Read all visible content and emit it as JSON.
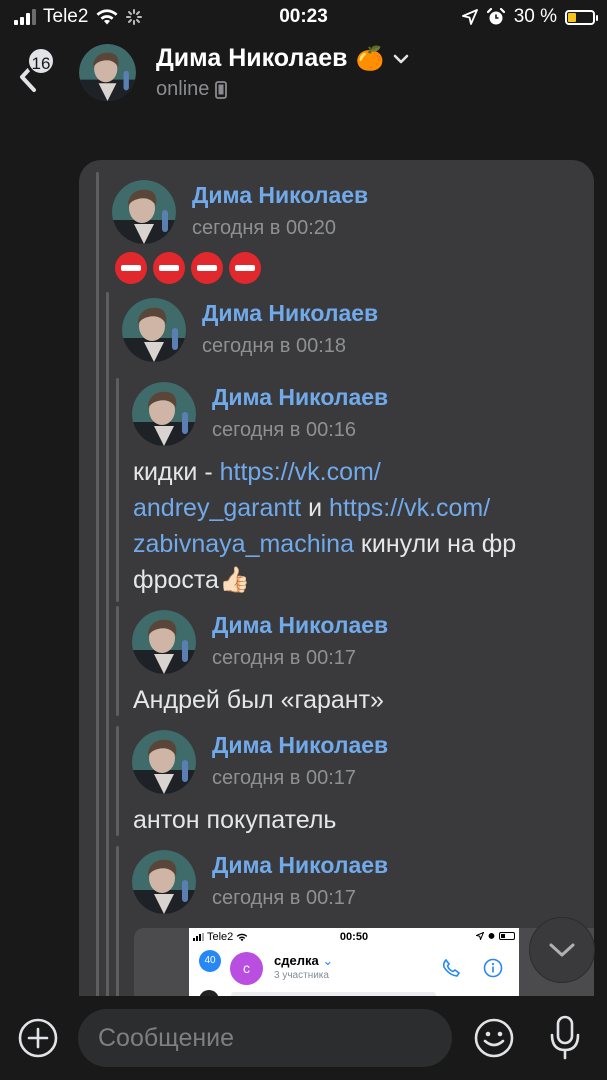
{
  "status_bar": {
    "carrier": "Tele2",
    "time": "00:23",
    "battery": "30 %",
    "battery_level": 0.3
  },
  "header": {
    "back_badge": "16",
    "contact_name": "Дима Николаев",
    "name_emoji": "🍊",
    "status": "online"
  },
  "messages": [
    {
      "author": "Дима Николаев",
      "time": "сегодня в 00:20",
      "text": "⛔⛔⛔⛔"
    },
    {
      "author": "Дима Николаев",
      "time": "сегодня в 00:18"
    },
    {
      "author": "Дима Николаев",
      "time": "сегодня в 00:16",
      "text_parts": [
        "кидки - ",
        "https://vk.com/",
        "andrey_garantt",
        " и ",
        "https://vk.com/",
        "zabivnaya_machina",
        " кинули на фр",
        "фроста",
        "👍🏻"
      ]
    },
    {
      "author": "Дима Николаев",
      "time": "сегодня в 00:17",
      "text": "Андрей был «гарант»"
    },
    {
      "author": "Дима Николаев",
      "time": "сегодня в 00:17",
      "text": "антон покупатель"
    },
    {
      "author": "Дима Николаев",
      "time": "сегодня в 00:17"
    }
  ],
  "embedded_screenshot": {
    "carrier": "Tele2",
    "time": "00:50",
    "back_badge": "40",
    "avatar_letter": "с",
    "chat_title": "сделка",
    "chat_subtitle": "3 участника"
  },
  "input": {
    "placeholder": "Сообщение"
  },
  "colors": {
    "background": "#19191a",
    "bubble": "#3a3a3c",
    "accent_link": "#71aaeb",
    "battery_fill": "#f5c518"
  }
}
